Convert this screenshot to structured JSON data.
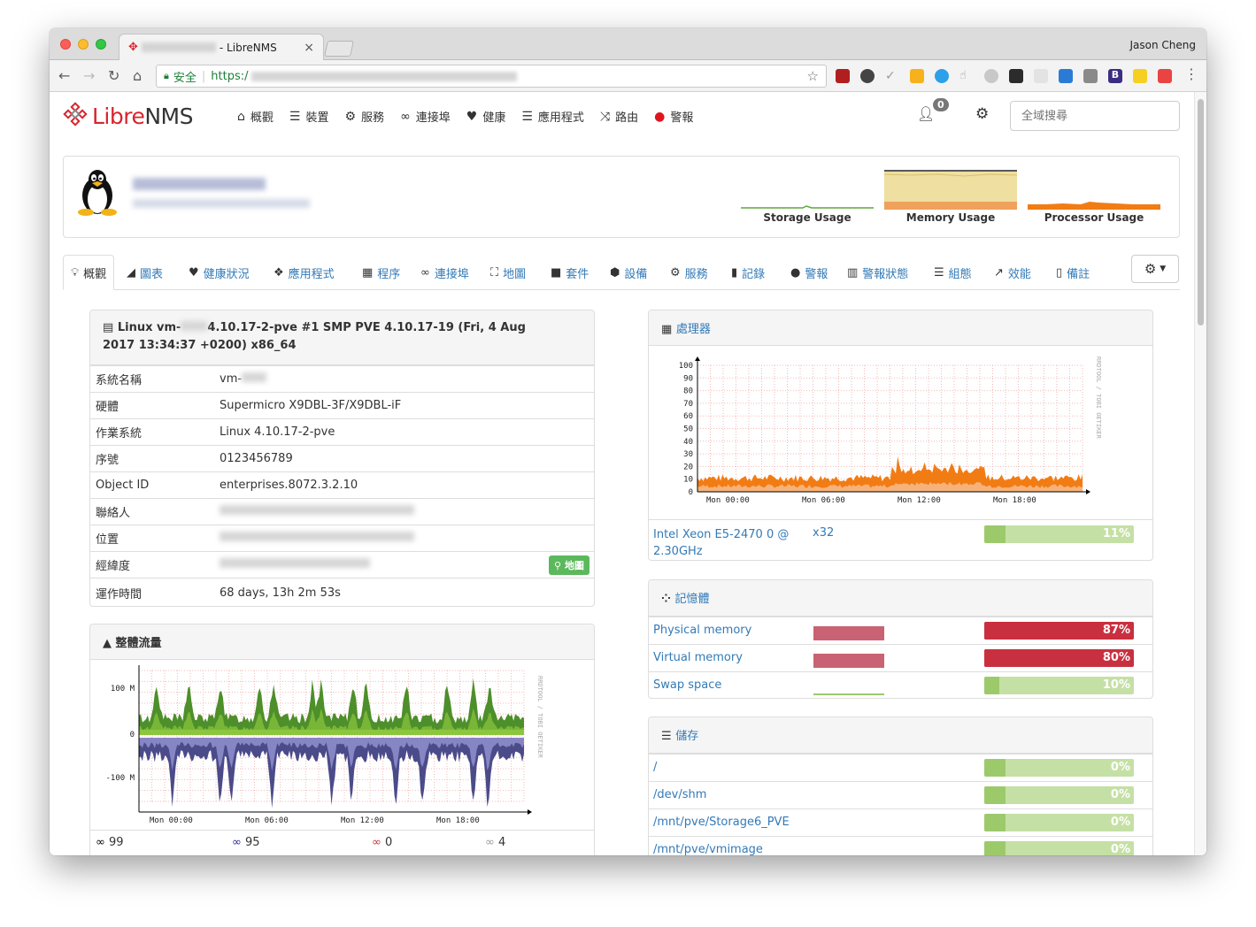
{
  "browser": {
    "tab_title": " - LibreNMS",
    "user": "Jason Cheng",
    "address_secure": "安全",
    "address_https": "https:/"
  },
  "navbar": {
    "logo_libre": "Libre",
    "logo_nms": "NMS",
    "menu": [
      {
        "label": "概觀",
        "icon": "home-icon"
      },
      {
        "label": "裝置",
        "icon": "server-icon"
      },
      {
        "label": "服務",
        "icon": "cogs-icon"
      },
      {
        "label": "連接埠",
        "icon": "link-icon"
      },
      {
        "label": "健康",
        "icon": "heartbeat-icon"
      },
      {
        "label": "應用程式",
        "icon": "tasks-icon"
      },
      {
        "label": "路由",
        "icon": "random-icon"
      },
      {
        "label": "警報",
        "icon": "exclamation-circle-icon"
      }
    ],
    "alert_count": "0",
    "search_placeholder": "全域搜尋"
  },
  "device": {
    "graphs": [
      {
        "label": "Storage Usage"
      },
      {
        "label": "Memory Usage"
      },
      {
        "label": "Processor Usage"
      }
    ]
  },
  "subnav": [
    {
      "label": "概觀",
      "icon": "lightbulb-icon",
      "active": true
    },
    {
      "label": "圖表",
      "icon": "area-chart-icon"
    },
    {
      "label": "健康狀況",
      "icon": "heartbeat-icon"
    },
    {
      "label": "應用程式",
      "icon": "cubes-icon"
    },
    {
      "label": "程序",
      "icon": "microchip-icon"
    },
    {
      "label": "連接埠",
      "icon": "link-icon"
    },
    {
      "label": "地圖",
      "icon": "sitemap-icon"
    },
    {
      "label": "套件",
      "icon": "folder-icon"
    },
    {
      "label": "設備",
      "icon": "cube-icon"
    },
    {
      "label": "服務",
      "icon": "cogs-icon"
    },
    {
      "label": "記錄",
      "icon": "book-icon"
    },
    {
      "label": "警報",
      "icon": "exclamation-circle-icon"
    },
    {
      "label": "警報狀態",
      "icon": "bar-chart-icon"
    },
    {
      "label": "組態",
      "icon": "align-justify-icon"
    },
    {
      "label": "效能",
      "icon": "line-chart-icon"
    },
    {
      "label": "備註",
      "icon": "file-text-icon"
    }
  ],
  "overview": {
    "title_a": "Linux vm-",
    "title_b": "4.10.17-2-pve #1 SMP PVE 4.10.17-19 (Fri, 4 Aug",
    "title_c": "2017 13:34:37 +0200) x86_64",
    "rows": [
      {
        "k": "系統名稱",
        "v": "vm-"
      },
      {
        "k": "硬體",
        "v": "Supermicro X9DBL-3F/X9DBL-iF"
      },
      {
        "k": "作業系統",
        "v": "Linux 4.10.17-2-pve"
      },
      {
        "k": "序號",
        "v": "0123456789"
      },
      {
        "k": "Object ID",
        "v": "enterprises.8072.3.2.10"
      },
      {
        "k": "聯絡人",
        "v": ""
      },
      {
        "k": "位置",
        "v": ""
      },
      {
        "k": "經緯度",
        "v": ""
      },
      {
        "k": "運作時間",
        "v": "68 days, 13h 2m 53s"
      }
    ],
    "map_button": "地圖"
  },
  "traffic": {
    "title": "整體流量",
    "y_ticks": [
      "100 M",
      "0",
      "-100 M"
    ],
    "x_ticks": [
      "Mon 00:00",
      "Mon 06:00",
      "Mon 12:00",
      "Mon 18:00"
    ],
    "watermark": "RRDTOOL / TOBI OETIKER",
    "ports": [
      {
        "count": "99",
        "color": "#000000"
      },
      {
        "count": "95",
        "color": "#2a2a9e"
      },
      {
        "count": "0",
        "color": "#c9303f"
      },
      {
        "count": "4",
        "color": "#999999"
      }
    ]
  },
  "processor": {
    "title": "處理器",
    "y_ticks": [
      "100",
      "90",
      "80",
      "70",
      "60",
      "50",
      "40",
      "30",
      "20",
      "10",
      "0"
    ],
    "x_ticks": [
      "Mon 00:00",
      "Mon 06:00",
      "Mon 12:00",
      "Mon 18:00"
    ],
    "watermark": "RRDTOOL / TOBI OETIKER",
    "cpu_name": "Intel Xeon E5-2470 0 @",
    "cpu_name2": "2.30GHz",
    "cpu_count": "x32",
    "usage": "11%",
    "usage_pct": 11
  },
  "memory": {
    "title": "記憶體",
    "rows": [
      {
        "label": "Physical memory",
        "value": "87%",
        "pct": 87,
        "level": "high"
      },
      {
        "label": "Virtual memory",
        "value": "80%",
        "pct": 80,
        "level": "high"
      },
      {
        "label": "Swap space",
        "value": "10%",
        "pct": 10,
        "level": "low"
      }
    ]
  },
  "storage": {
    "title": "儲存",
    "rows": [
      {
        "label": "/",
        "value": "0%",
        "pct": 0
      },
      {
        "label": "/dev/shm",
        "value": "0%",
        "pct": 0
      },
      {
        "label": "/mnt/pve/Storage6_PVE",
        "value": "0%",
        "pct": 0
      },
      {
        "label": "/mnt/pve/vmimage",
        "value": "0%",
        "pct": 0
      }
    ]
  },
  "colors": {
    "brand": "#d9242d",
    "link": "#337ab7",
    "bar_ok": "#9cca6b",
    "bar_bg": "#c5e0a5",
    "bar_high": "#c9303f",
    "cpu_graph": "#f27c14"
  }
}
